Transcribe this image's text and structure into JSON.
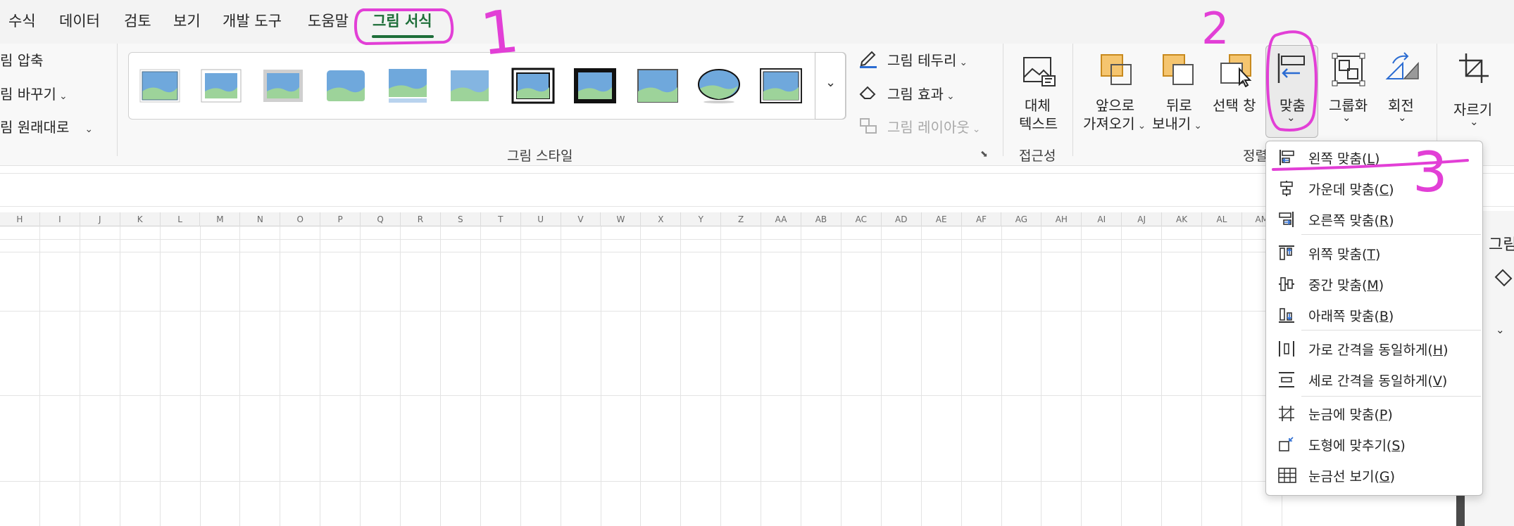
{
  "menu": {
    "items": [
      "수식",
      "데이터",
      "검토",
      "보기",
      "개발 도구",
      "도움말"
    ],
    "active": "그림 서식"
  },
  "ribbon": {
    "adjust": {
      "compress": "림 압축",
      "change": "림 바꾸기",
      "reset": "림 원래대로"
    },
    "styles": {
      "border": "그림 테두리",
      "effects": "그림 효과",
      "layout": "그림 레이아웃",
      "group_label": "그림 스타일"
    },
    "accessibility": {
      "alt_text_line1": "대체",
      "alt_text_line2": "텍스트",
      "group_label": "접근성"
    },
    "arrange": {
      "bring_forward_line1": "앞으로",
      "bring_forward_line2": "가져오기",
      "send_backward_line1": "뒤로",
      "send_backward_line2": "보내기",
      "selection_pane": "선택 창",
      "align": "맞춤",
      "group": "그룹화",
      "rotate": "회전",
      "group_label": "정렬"
    },
    "size": {
      "crop": "자르기"
    }
  },
  "columns": [
    "H",
    "I",
    "J",
    "K",
    "L",
    "M",
    "N",
    "O",
    "P",
    "Q",
    "R",
    "S",
    "T",
    "U",
    "V",
    "W",
    "X",
    "Y",
    "Z",
    "AA",
    "AB",
    "AC",
    "AD",
    "AE",
    "AF",
    "AG",
    "AH",
    "AI",
    "AJ",
    "AK",
    "AL",
    "AM"
  ],
  "align_menu": {
    "items": [
      {
        "label": "왼쪽 맞춤",
        "key": "L",
        "icon": "align-left-icon"
      },
      {
        "label": "가운데 맞춤",
        "key": "C",
        "icon": "align-center-icon"
      },
      {
        "label": "오른쪽 맞춤",
        "key": "R",
        "icon": "align-right-icon"
      },
      {
        "label": "위쪽 맞춤",
        "key": "T",
        "icon": "align-top-icon"
      },
      {
        "label": "중간 맞춤",
        "key": "M",
        "icon": "align-middle-icon"
      },
      {
        "label": "아래쪽 맞춤",
        "key": "B",
        "icon": "align-bottom-icon"
      },
      {
        "label": "가로 간격을 동일하게",
        "key": "H",
        "icon": "distribute-horizontal-icon"
      },
      {
        "label": "세로 간격을 동일하게",
        "key": "V",
        "icon": "distribute-vertical-icon"
      },
      {
        "label": "눈금에 맞춤",
        "key": "P",
        "icon": "snap-to-grid-icon"
      },
      {
        "label": "도형에 맞추기",
        "key": "S",
        "icon": "snap-to-shape-icon"
      },
      {
        "label": "눈금선 보기",
        "key": "G",
        "icon": "view-gridlines-icon"
      }
    ]
  },
  "right_pane": {
    "title_fragment": "그림"
  },
  "annotations": {
    "step1": "1",
    "step2": "2",
    "step3": "3",
    "color": "#e23fd6"
  },
  "colors": {
    "active_tab": "#1e6e39",
    "picture_sky": "#6fa8dc",
    "picture_hill": "#9dd39a"
  }
}
